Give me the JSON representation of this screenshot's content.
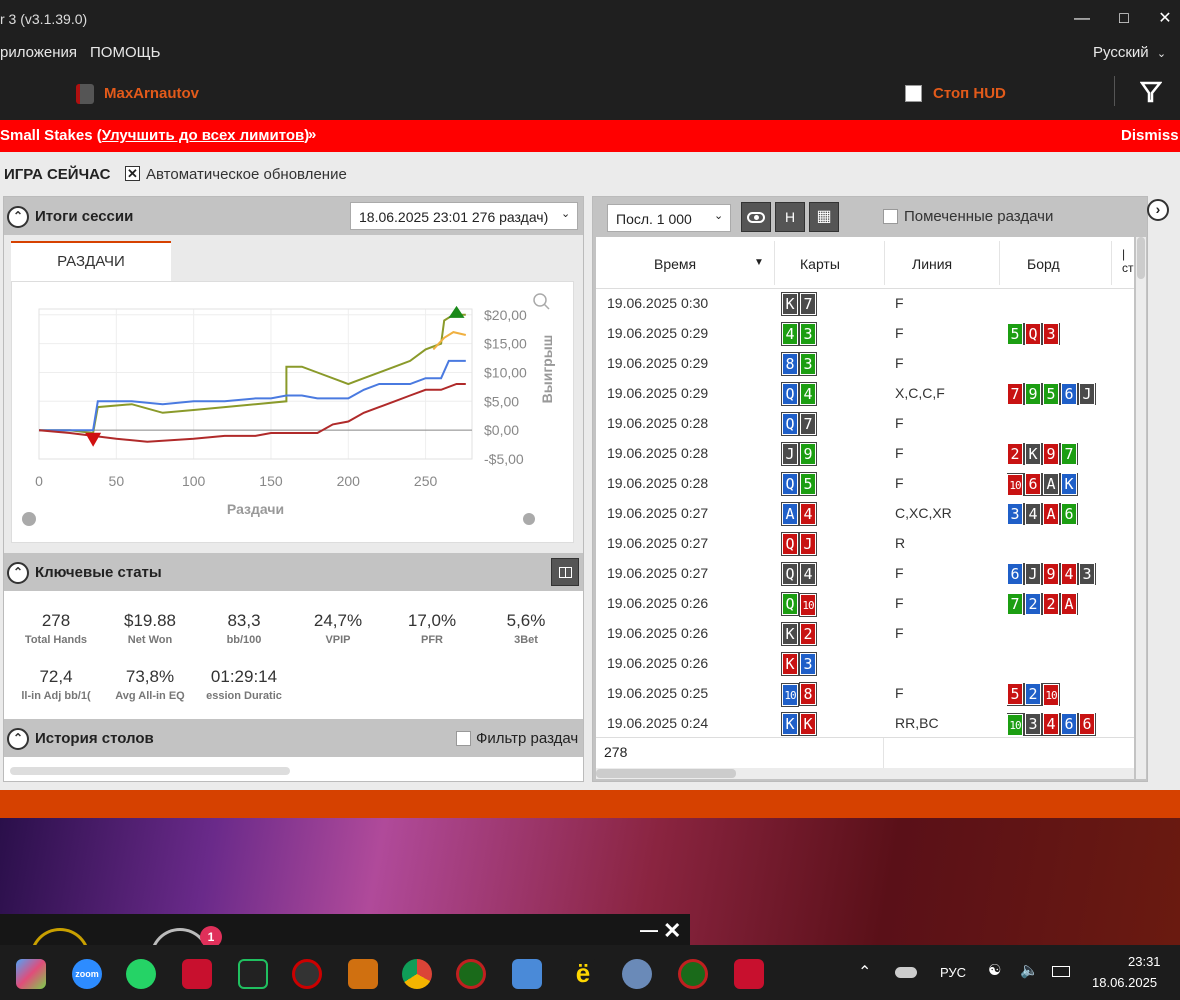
{
  "window": {
    "title": "r 3 (v3.1.39.0)"
  },
  "menu": {
    "items": [
      "риложения",
      "ПОМОЩЬ"
    ],
    "language": "Русский"
  },
  "user": {
    "name": "MaxArnautov",
    "stop_hud": "Стоп HUD"
  },
  "promo": {
    "prefix": "Small Stakes (",
    "link": "Улучшить до всех лимитов",
    "suffix": ")",
    "arrow": "»",
    "dismiss": "Dismiss"
  },
  "live": {
    "title": "ИГРА СЕЙЧАС",
    "auto_refresh": "Автоматическое обновление",
    "auto_checked": true
  },
  "session": {
    "title": "Итоги сессии",
    "selector": "18.06.2025 23:01 276 раздач)",
    "tab": "РАЗДАЧИ"
  },
  "chart_data": {
    "type": "line",
    "xlabel": "Раздачи",
    "ylabel": "Выигрыш",
    "xlim": [
      0,
      280
    ],
    "ylim": [
      -5,
      21
    ],
    "xticks": [
      "0",
      "50",
      "100",
      "150",
      "200",
      "250"
    ],
    "yticks": [
      "$20,00",
      "$15,00",
      "$10,00",
      "$5,00",
      "$0,00",
      "-$5,00"
    ],
    "series": [
      {
        "color": "#8a9a2a",
        "x": [
          0,
          20,
          35,
          38,
          60,
          80,
          100,
          120,
          140,
          160,
          160,
          170,
          180,
          200,
          210,
          230,
          240,
          250,
          260,
          262,
          268,
          276
        ],
        "y": [
          0,
          0,
          -0.5,
          4,
          4.5,
          3,
          3.5,
          4,
          4.5,
          5,
          11,
          11,
          10,
          8,
          9,
          11,
          12,
          14,
          15,
          19,
          20,
          20
        ]
      },
      {
        "color": "#4a7ae0",
        "x": [
          0,
          20,
          35,
          38,
          60,
          80,
          100,
          120,
          140,
          150,
          160,
          170,
          180,
          200,
          210,
          220,
          230,
          240,
          250,
          260,
          265,
          276
        ],
        "y": [
          0,
          0,
          0,
          5,
          5,
          4.5,
          5,
          5,
          5.5,
          5.5,
          6,
          6,
          5.5,
          5.5,
          7,
          8,
          8,
          8,
          9,
          9,
          12,
          12
        ]
      },
      {
        "color": "#b02a2a",
        "x": [
          0,
          20,
          35,
          50,
          70,
          100,
          120,
          140,
          150,
          160,
          180,
          190,
          200,
          210,
          220,
          230,
          240,
          250,
          260,
          270,
          276
        ],
        "y": [
          0,
          -0.5,
          -1,
          -1.5,
          -2,
          -1.5,
          -1,
          -1,
          -0.5,
          -0.5,
          -0.5,
          1,
          1.5,
          3,
          4,
          5,
          6,
          7,
          7,
          8,
          8
        ]
      },
      {
        "color": "#f0b040",
        "x": [
          255,
          262,
          268,
          276
        ],
        "y": [
          14,
          16,
          17,
          16.5
        ]
      }
    ],
    "markers": [
      {
        "type": "max",
        "x": 270,
        "y": 20.5,
        "color": "#1a8a1a"
      },
      {
        "type": "min",
        "x": 35,
        "y": -1.5,
        "color": "#d01010"
      }
    ],
    "grid": true
  },
  "stats": {
    "title": "Ключевые статы",
    "items": [
      {
        "value": "278",
        "label": "Total Hands"
      },
      {
        "value": "$19.88",
        "label": "Net Won"
      },
      {
        "value": "83,3",
        "label": "bb/100"
      },
      {
        "value": "24,7%",
        "label": "VPIP"
      },
      {
        "value": "17,0%",
        "label": "PFR"
      },
      {
        "value": "5,6%",
        "label": "3Bet"
      },
      {
        "value": "72,4",
        "label": "ll-in Adj bb/1("
      },
      {
        "value": "73,8%",
        "label": "Avg All-in EQ"
      },
      {
        "value": "01:29:14",
        "label": "ession Duratic"
      }
    ]
  },
  "tables": {
    "title": "История столов",
    "filter": "Фильтр раздач"
  },
  "hands": {
    "filter": "Посл. 1 000",
    "h_btn": "H",
    "marked": "Помеченные раздачи",
    "columns": [
      "Время",
      "Карты",
      "Линия",
      "Борд"
    ],
    "extra_col": "| ст",
    "rows": [
      {
        "time": "19.06.2025 0:30",
        "cards": [
          [
            "K",
            "s"
          ],
          [
            "7",
            "s"
          ]
        ],
        "line": "F",
        "board": []
      },
      {
        "time": "19.06.2025 0:29",
        "cards": [
          [
            "4",
            "c"
          ],
          [
            "3",
            "c"
          ]
        ],
        "line": "F",
        "board": [
          [
            "5",
            "c"
          ],
          [
            "Q",
            "h"
          ],
          [
            "3",
            "h"
          ]
        ]
      },
      {
        "time": "19.06.2025 0:29",
        "cards": [
          [
            "8",
            "d"
          ],
          [
            "3",
            "c"
          ]
        ],
        "line": "F",
        "board": []
      },
      {
        "time": "19.06.2025 0:29",
        "cards": [
          [
            "Q",
            "d"
          ],
          [
            "4",
            "c"
          ]
        ],
        "line": "X,C,C,F",
        "board": [
          [
            "7",
            "h"
          ],
          [
            "9",
            "c"
          ],
          [
            "5",
            "c"
          ],
          [
            "6",
            "d"
          ],
          [
            "J",
            "s"
          ]
        ]
      },
      {
        "time": "19.06.2025 0:28",
        "cards": [
          [
            "Q",
            "d"
          ],
          [
            "7",
            "s"
          ]
        ],
        "line": "F",
        "board": []
      },
      {
        "time": "19.06.2025 0:28",
        "cards": [
          [
            "J",
            "s"
          ],
          [
            "9",
            "c"
          ]
        ],
        "line": "F",
        "board": [
          [
            "2",
            "h"
          ],
          [
            "K",
            "s"
          ],
          [
            "9",
            "h"
          ],
          [
            "7",
            "c"
          ]
        ]
      },
      {
        "time": "19.06.2025 0:28",
        "cards": [
          [
            "Q",
            "d"
          ],
          [
            "5",
            "c"
          ]
        ],
        "line": "F",
        "board": [
          [
            "10",
            "h"
          ],
          [
            "6",
            "h"
          ],
          [
            "A",
            "s"
          ],
          [
            "K",
            "d"
          ]
        ]
      },
      {
        "time": "19.06.2025 0:27",
        "cards": [
          [
            "A",
            "d"
          ],
          [
            "4",
            "h"
          ]
        ],
        "line": "C,XC,XR",
        "board": [
          [
            "3",
            "d"
          ],
          [
            "4",
            "s"
          ],
          [
            "A",
            "h"
          ],
          [
            "6",
            "c"
          ]
        ]
      },
      {
        "time": "19.06.2025 0:27",
        "cards": [
          [
            "Q",
            "h"
          ],
          [
            "J",
            "h"
          ]
        ],
        "line": "R",
        "board": []
      },
      {
        "time": "19.06.2025 0:27",
        "cards": [
          [
            "Q",
            "s"
          ],
          [
            "4",
            "s"
          ]
        ],
        "line": "F",
        "board": [
          [
            "6",
            "d"
          ],
          [
            "J",
            "s"
          ],
          [
            "9",
            "h"
          ],
          [
            "4",
            "h"
          ],
          [
            "3",
            "s"
          ]
        ]
      },
      {
        "time": "19.06.2025 0:26",
        "cards": [
          [
            "Q",
            "c"
          ],
          [
            "10",
            "h"
          ]
        ],
        "line": "F",
        "board": [
          [
            "7",
            "c"
          ],
          [
            "2",
            "d"
          ],
          [
            "2",
            "h"
          ],
          [
            "A",
            "h"
          ]
        ]
      },
      {
        "time": "19.06.2025 0:26",
        "cards": [
          [
            "K",
            "s"
          ],
          [
            "2",
            "h"
          ]
        ],
        "line": "F",
        "board": []
      },
      {
        "time": "19.06.2025 0:26",
        "cards": [
          [
            "K",
            "h"
          ],
          [
            "3",
            "d"
          ]
        ],
        "line": "",
        "board": []
      },
      {
        "time": "19.06.2025 0:25",
        "cards": [
          [
            "10",
            "d"
          ],
          [
            "8",
            "h"
          ]
        ],
        "line": "F",
        "board": [
          [
            "5",
            "h"
          ],
          [
            "2",
            "d"
          ],
          [
            "10",
            "h"
          ]
        ]
      },
      {
        "time": "19.06.2025 0:24",
        "cards": [
          [
            "K",
            "d"
          ],
          [
            "K",
            "h"
          ]
        ],
        "line": "RR,BC",
        "board": [
          [
            "10",
            "c"
          ],
          [
            "3",
            "s"
          ],
          [
            "4",
            "h"
          ],
          [
            "6",
            "d"
          ],
          [
            "6",
            "h"
          ]
        ]
      }
    ],
    "total": "278"
  },
  "taskbar": {
    "lang": "РУС",
    "time": "23:31",
    "date": "18.06.2025",
    "badge": "1",
    "zoom": "zoom"
  }
}
